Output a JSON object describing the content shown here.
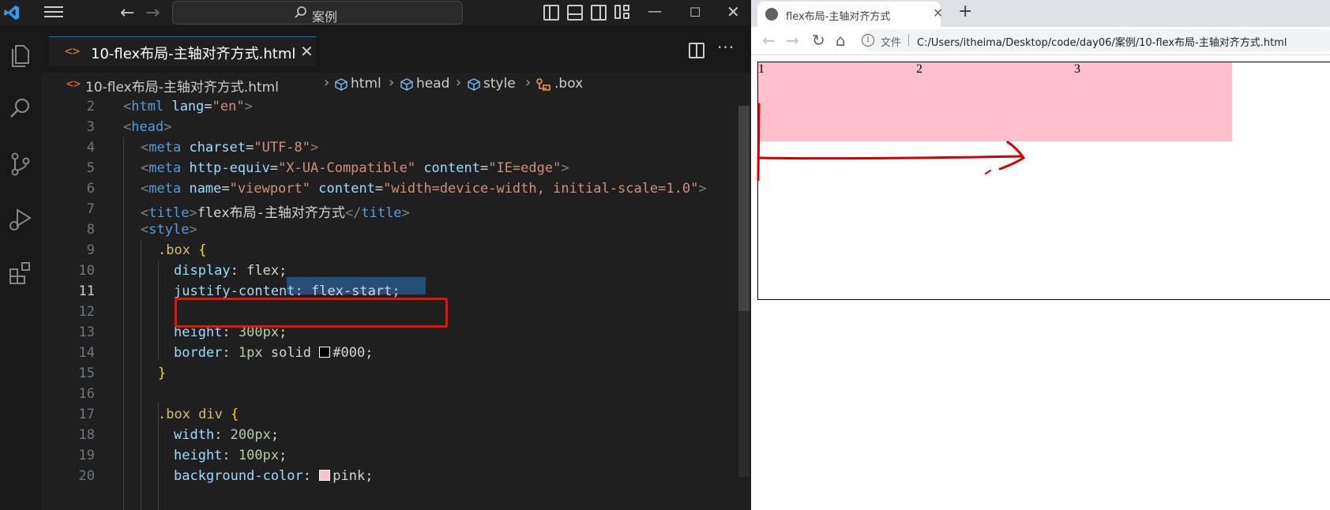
{
  "vscode": {
    "search_text": "案例",
    "tab": {
      "label": "10-flex布局-主轴对齐方式.html",
      "icon": "html-file-icon"
    },
    "breadcrumb": [
      {
        "label": "10-flex布局-主轴对齐方式.html",
        "icon": "html-file-icon"
      },
      {
        "label": "html",
        "icon": "cube-icon"
      },
      {
        "label": "head",
        "icon": "cube-icon"
      },
      {
        "label": "style",
        "icon": "cube-icon"
      },
      {
        "label": ".box",
        "icon": "selector-icon"
      }
    ],
    "current_line": 11,
    "highlight_color": "#e51400",
    "code_lines": [
      {
        "num": "2",
        "text": "<html lang=\"en\">"
      },
      {
        "num": "3",
        "text": "<head>"
      },
      {
        "num": "4",
        "text": "<meta charset=\"UTF-8\">"
      },
      {
        "num": "5",
        "text": "<meta http-equiv=\"X-UA-Compatible\" content=\"IE=edge\">"
      },
      {
        "num": "6",
        "text": "<meta name=\"viewport\" content=\"width=device-width, initial-scale=1.0\">"
      },
      {
        "num": "7",
        "text": "<title>flex布局-主轴对齐方式</title>"
      },
      {
        "num": "8",
        "text": "<style>"
      },
      {
        "num": "9",
        "text": ".box {"
      },
      {
        "num": "10",
        "text": "display: flex;"
      },
      {
        "num": "11",
        "text": "justify-content: flex-start;"
      },
      {
        "num": "12",
        "text": ""
      },
      {
        "num": "13",
        "text": "height: 300px;"
      },
      {
        "num": "14",
        "text": "border: 1px solid #000;"
      },
      {
        "num": "15",
        "text": "}"
      },
      {
        "num": "16",
        "text": ""
      },
      {
        "num": "17",
        "text": ".box div {"
      },
      {
        "num": "18",
        "text": "width: 200px;"
      },
      {
        "num": "19",
        "text": "height: 100px;"
      },
      {
        "num": "20",
        "text": "background-color: pink;"
      }
    ]
  },
  "browser": {
    "tab_title": "flex布局-主轴对齐方式",
    "scheme_label": "文件",
    "url": "C:/Users/itheima/Desktop/code/day06/案例/10-flex布局-主轴对齐方式.html",
    "items": [
      "1",
      "2",
      "3"
    ],
    "item_color": "#ffc0cb",
    "annotation_color": "#d40000"
  }
}
